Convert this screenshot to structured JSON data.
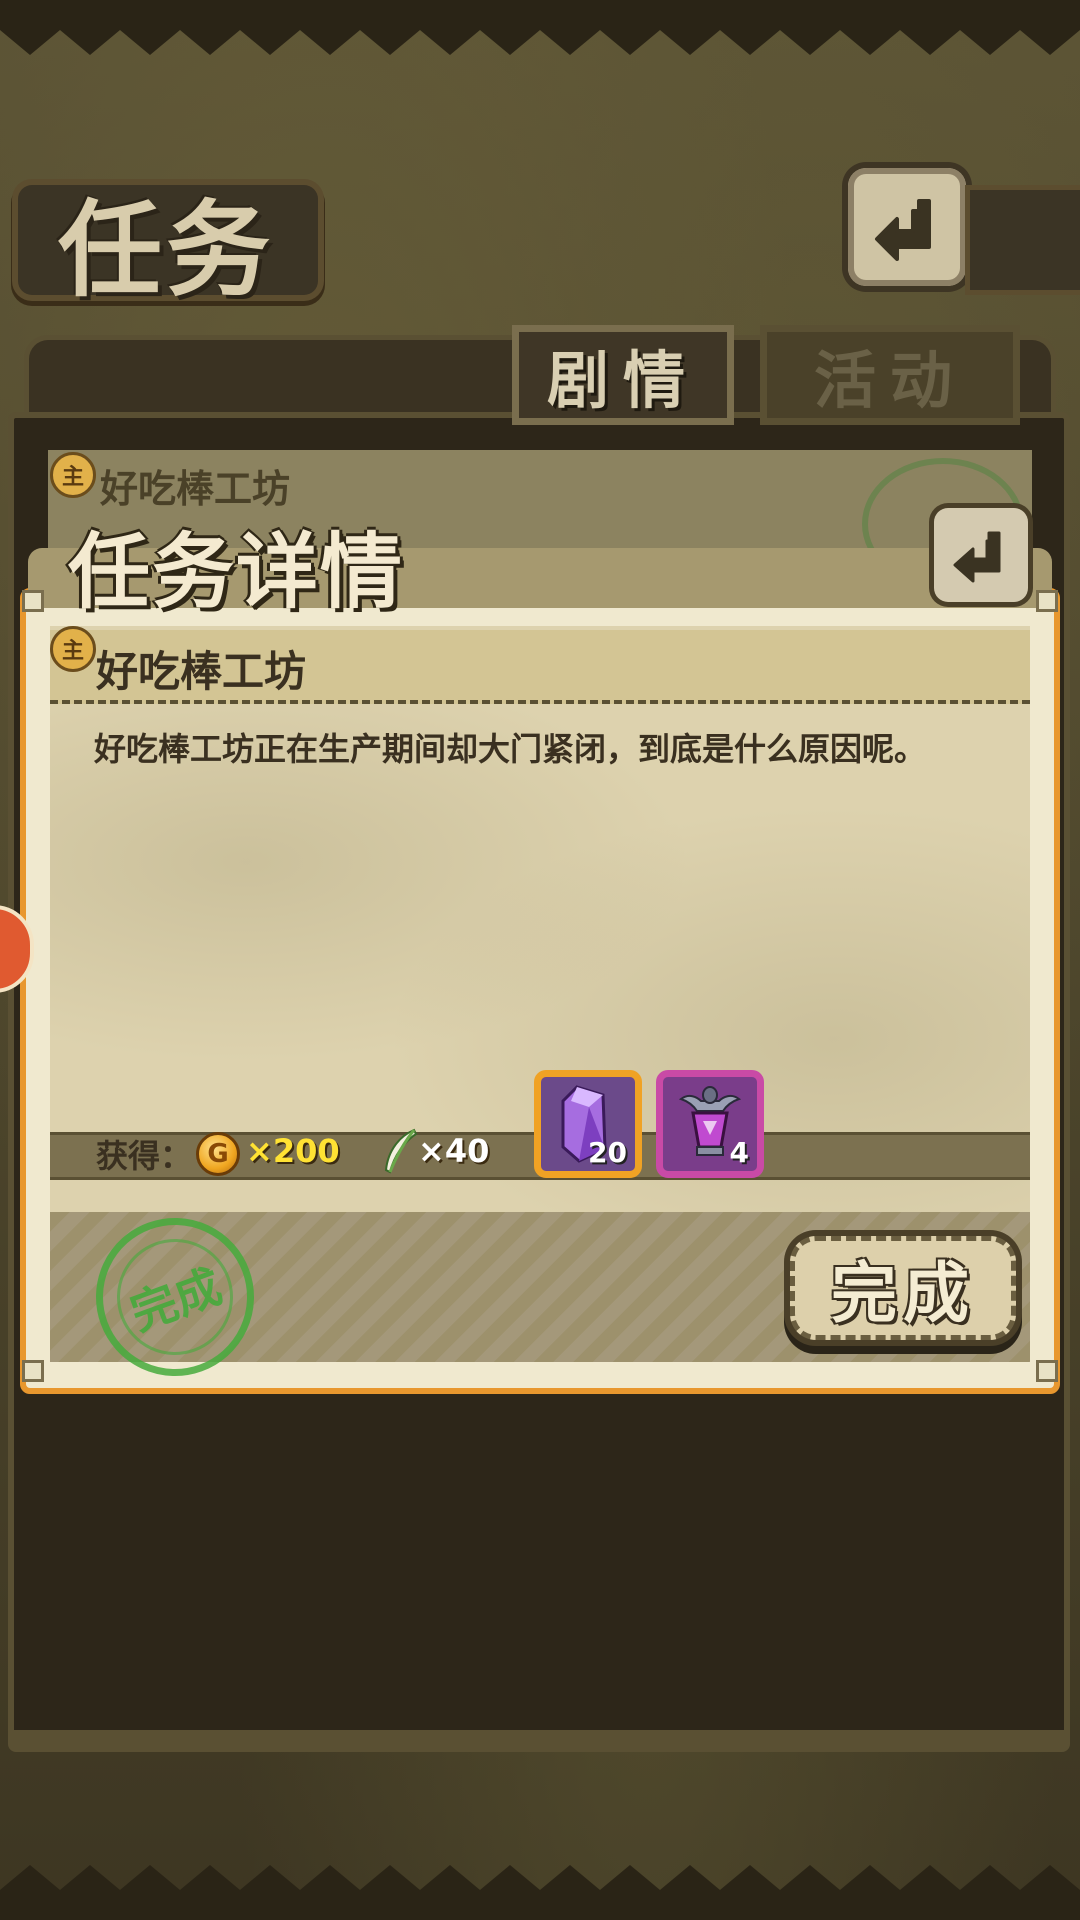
{
  "header": {
    "title": "任务"
  },
  "tabs": [
    {
      "label": "剧情",
      "active": true
    },
    {
      "label": "活动",
      "active": false
    }
  ],
  "list": {
    "first_item_title": "好吃棒工坊",
    "badge": "主"
  },
  "detail": {
    "title": "任务详情",
    "quest_name": "好吃棒工坊",
    "badge": "主",
    "description": "好吃棒工坊正在生产期间却大门紧闭，到底是什么原因呢。",
    "rewards": {
      "label": "获得：",
      "coin_icon": "gold-coin-icon",
      "coin_letter": "G",
      "coin_amount": "×200",
      "feather_icon": "feather-icon",
      "feather_amount": "×40",
      "items": [
        {
          "icon": "purple-crystal-icon",
          "count": "20"
        },
        {
          "icon": "purple-potion-icon",
          "count": "4"
        }
      ]
    },
    "stamp_text": "完成",
    "complete_button": "完成"
  },
  "colors": {
    "accent_orange": "#e8972e",
    "coin_text": "#ffe233",
    "stamp_green": "#46aa3c"
  }
}
